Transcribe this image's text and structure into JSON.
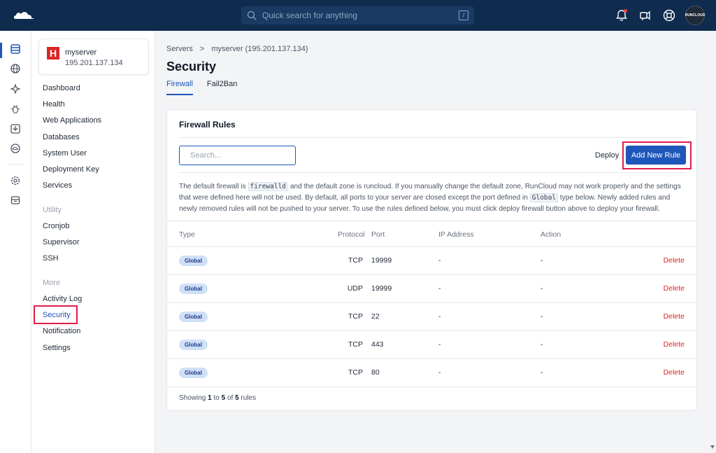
{
  "topbar": {
    "search_placeholder": "Quick search for anything",
    "search_shortcut": "/",
    "avatar_text": "RUNCLOUD"
  },
  "server": {
    "name": "myserver",
    "ip": "195.201.137.134",
    "logo_letter": "H"
  },
  "subnav": {
    "main_items": [
      "Dashboard",
      "Health",
      "Web Applications",
      "Databases",
      "System User",
      "Deployment Key",
      "Services"
    ],
    "utility_label": "Utility",
    "utility_items": [
      "Cronjob",
      "Supervisor",
      "SSH"
    ],
    "more_label": "More",
    "more_items": [
      "Activity Log",
      "Security",
      "Notification",
      "Settings"
    ]
  },
  "breadcrumb": {
    "root": "Servers",
    "separator": ">",
    "current": "myserver (195.201.137.134)"
  },
  "page": {
    "title": "Security",
    "tabs": [
      "Firewall",
      "Fail2Ban"
    ]
  },
  "card": {
    "title": "Firewall Rules",
    "search_placeholder": "Search...",
    "deploy_label": "Deploy",
    "add_rule_label": "Add New Rule",
    "notice": {
      "p1": "The default firewall is ",
      "code1": "firewalld",
      "p2": " and the default zone is runcloud. If you manually change the default zone, RunCloud may not work properly and the settings that were defined here will not be used. By default, all ports to your server are closed except the port defined in ",
      "code2": "Global",
      "p3": " type below. Newly added rules and newly removed rules will not be pushed to your server. To use the rules defined below, you must click deploy firewall button above to deploy your firewall."
    },
    "columns": {
      "type": "Type",
      "protocol": "Protocol",
      "port": "Port",
      "ip": "IP Address",
      "action": "Action"
    },
    "rows": [
      {
        "type": "Global",
        "protocol": "TCP",
        "port": "19999",
        "ip": "-",
        "action": "-",
        "delete": "Delete"
      },
      {
        "type": "Global",
        "protocol": "UDP",
        "port": "19999",
        "ip": "-",
        "action": "-",
        "delete": "Delete"
      },
      {
        "type": "Global",
        "protocol": "TCP",
        "port": "22",
        "ip": "-",
        "action": "-",
        "delete": "Delete"
      },
      {
        "type": "Global",
        "protocol": "TCP",
        "port": "443",
        "ip": "-",
        "action": "-",
        "delete": "Delete"
      },
      {
        "type": "Global",
        "protocol": "TCP",
        "port": "80",
        "ip": "-",
        "action": "-",
        "delete": "Delete"
      }
    ],
    "footer": {
      "showing": "Showing ",
      "from": "1",
      "to_word": " to ",
      "to": "5",
      "of_word": " of ",
      "total": "5",
      "suffix": " rules"
    }
  },
  "colors": {
    "topbar": "#0f2b4d",
    "primary": "#1e56b9",
    "danger": "#dc2626",
    "highlight": "#e11d48"
  }
}
